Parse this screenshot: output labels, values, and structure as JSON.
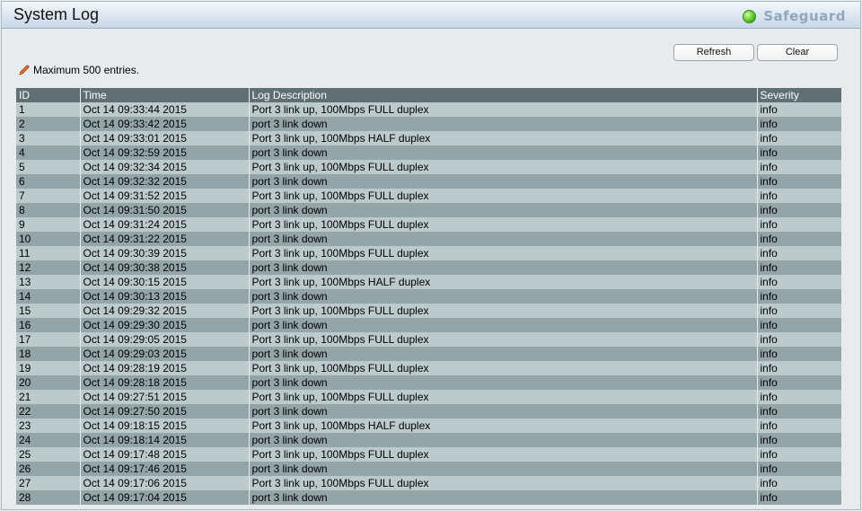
{
  "window": {
    "title": "System Log",
    "brand": "Safeguard"
  },
  "toolbar": {
    "refresh_label": "Refresh",
    "clear_label": "Clear"
  },
  "note": "Maximum 500 entries.",
  "colors": {
    "header_bg": "#5f6f73",
    "row_light": "#bccacc",
    "row_dark": "#93a5a8",
    "status_led": "#4cbf1f"
  },
  "table": {
    "headers": [
      "ID",
      "Time",
      "Log Description",
      "Severity"
    ],
    "rows": [
      [
        "1",
        "Oct 14 09:33:44 2015",
        "Port 3 link up, 100Mbps FULL duplex",
        "info"
      ],
      [
        "2",
        "Oct 14 09:33:42 2015",
        "port 3 link down",
        "info"
      ],
      [
        "3",
        "Oct 14 09:33:01 2015",
        "Port 3 link up, 100Mbps HALF duplex",
        "info"
      ],
      [
        "4",
        "Oct 14 09:32:59 2015",
        "port 3 link down",
        "info"
      ],
      [
        "5",
        "Oct 14 09:32:34 2015",
        "Port 3 link up, 100Mbps FULL duplex",
        "info"
      ],
      [
        "6",
        "Oct 14 09:32:32 2015",
        "port 3 link down",
        "info"
      ],
      [
        "7",
        "Oct 14 09:31:52 2015",
        "Port 3 link up, 100Mbps FULL duplex",
        "info"
      ],
      [
        "8",
        "Oct 14 09:31:50 2015",
        "port 3 link down",
        "info"
      ],
      [
        "9",
        "Oct 14 09:31:24 2015",
        "Port 3 link up, 100Mbps FULL duplex",
        "info"
      ],
      [
        "10",
        "Oct 14 09:31:22 2015",
        "port 3 link down",
        "info"
      ],
      [
        "11",
        "Oct 14 09:30:39 2015",
        "Port 3 link up, 100Mbps FULL duplex",
        "info"
      ],
      [
        "12",
        "Oct 14 09:30:38 2015",
        "port 3 link down",
        "info"
      ],
      [
        "13",
        "Oct 14 09:30:15 2015",
        "Port 3 link up, 100Mbps HALF duplex",
        "info"
      ],
      [
        "14",
        "Oct 14 09:30:13 2015",
        "port 3 link down",
        "info"
      ],
      [
        "15",
        "Oct 14 09:29:32 2015",
        "Port 3 link up, 100Mbps FULL duplex",
        "info"
      ],
      [
        "16",
        "Oct 14 09:29:30 2015",
        "port 3 link down",
        "info"
      ],
      [
        "17",
        "Oct 14 09:29:05 2015",
        "Port 3 link up, 100Mbps FULL duplex",
        "info"
      ],
      [
        "18",
        "Oct 14 09:29:03 2015",
        "port 3 link down",
        "info"
      ],
      [
        "19",
        "Oct 14 09:28:19 2015",
        "Port 3 link up, 100Mbps FULL duplex",
        "info"
      ],
      [
        "20",
        "Oct 14 09:28:18 2015",
        "port 3 link down",
        "info"
      ],
      [
        "21",
        "Oct 14 09:27:51 2015",
        "Port 3 link up, 100Mbps FULL duplex",
        "info"
      ],
      [
        "22",
        "Oct 14 09:27:50 2015",
        "port 3 link down",
        "info"
      ],
      [
        "23",
        "Oct 14 09:18:15 2015",
        "Port 3 link up, 100Mbps HALF duplex",
        "info"
      ],
      [
        "24",
        "Oct 14 09:18:14 2015",
        "port 3 link down",
        "info"
      ],
      [
        "25",
        "Oct 14 09:17:48 2015",
        "Port 3 link up, 100Mbps FULL duplex",
        "info"
      ],
      [
        "26",
        "Oct 14 09:17:46 2015",
        "port 3 link down",
        "info"
      ],
      [
        "27",
        "Oct 14 09:17:06 2015",
        "Port 3 link up, 100Mbps FULL duplex",
        "info"
      ],
      [
        "28",
        "Oct 14 09:17:04 2015",
        "port 3 link down",
        "info"
      ]
    ]
  }
}
